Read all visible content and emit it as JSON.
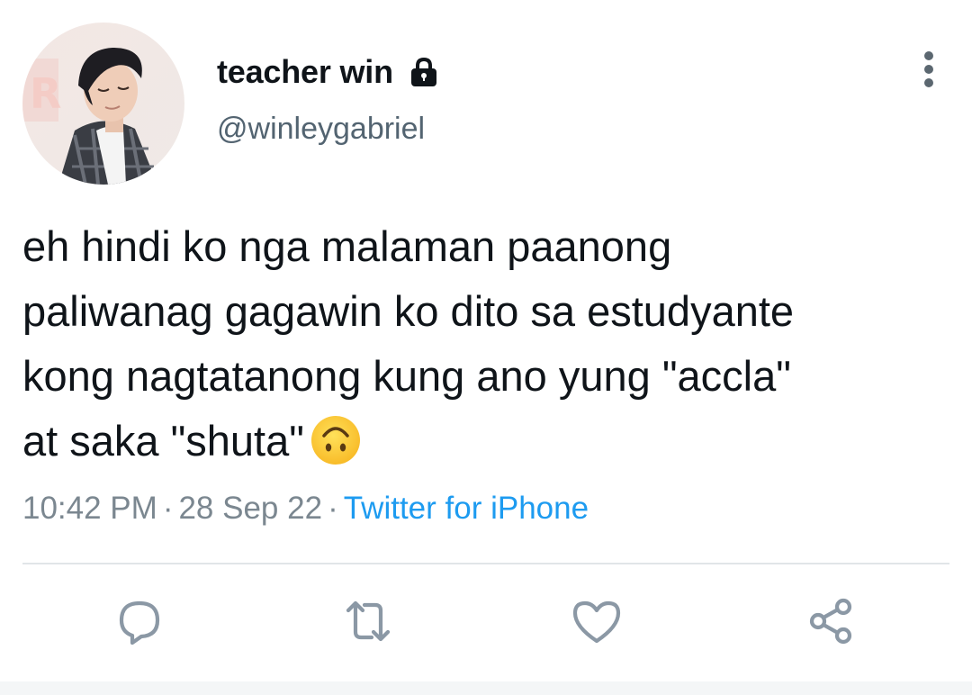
{
  "author": {
    "display_name": "teacher win",
    "handle": "@winleygabriel",
    "protected": true
  },
  "tweet": {
    "lines": [
      "eh hindi ko nga malaman paanong",
      "paliwanag gagawin ko dito sa estudyante",
      "kong nagtatanong kung ano yung \"accla\"",
      "at saka \"shuta\""
    ],
    "emoji": "upside-down-face-emoji"
  },
  "meta": {
    "time": "10:42 PM",
    "date": "28 Sep 22",
    "separator": "·",
    "source": "Twitter for iPhone"
  },
  "actions": [
    "reply-icon",
    "retweet-icon",
    "like-icon",
    "share-icon"
  ],
  "colors": {
    "text": "#0f1419",
    "secondary": "#536471",
    "link": "#1d9bf0",
    "icon": "#8b98a5",
    "divider": "#e1e5e8"
  }
}
